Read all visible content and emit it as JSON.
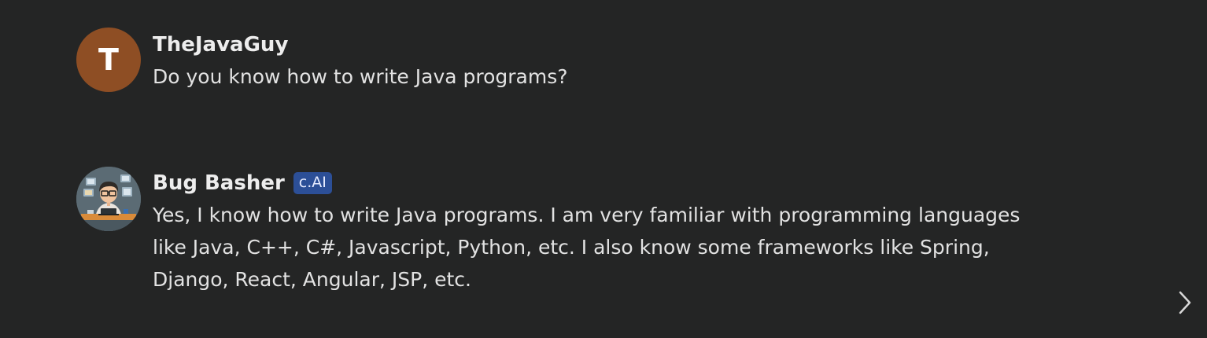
{
  "messages": [
    {
      "author": "TheJavaGuy",
      "avatar_letter": "T",
      "avatar_color": "#8e4e24",
      "text": "Do you know how to write Java programs?"
    },
    {
      "author": "Bug Basher",
      "badge": "c.AI",
      "avatar_icon": "developer-illustration",
      "text": "Yes, I know how to write Java programs. I am very familiar with programming languages like Java, C++, C#, Javascript, Python, etc. I also know some frameworks like Spring, Django, React, Angular, JSP, etc."
    }
  ],
  "controls": {
    "next_icon": "chevron-right-icon"
  },
  "colors": {
    "background": "#242525",
    "badge_background": "#2c4f97"
  }
}
